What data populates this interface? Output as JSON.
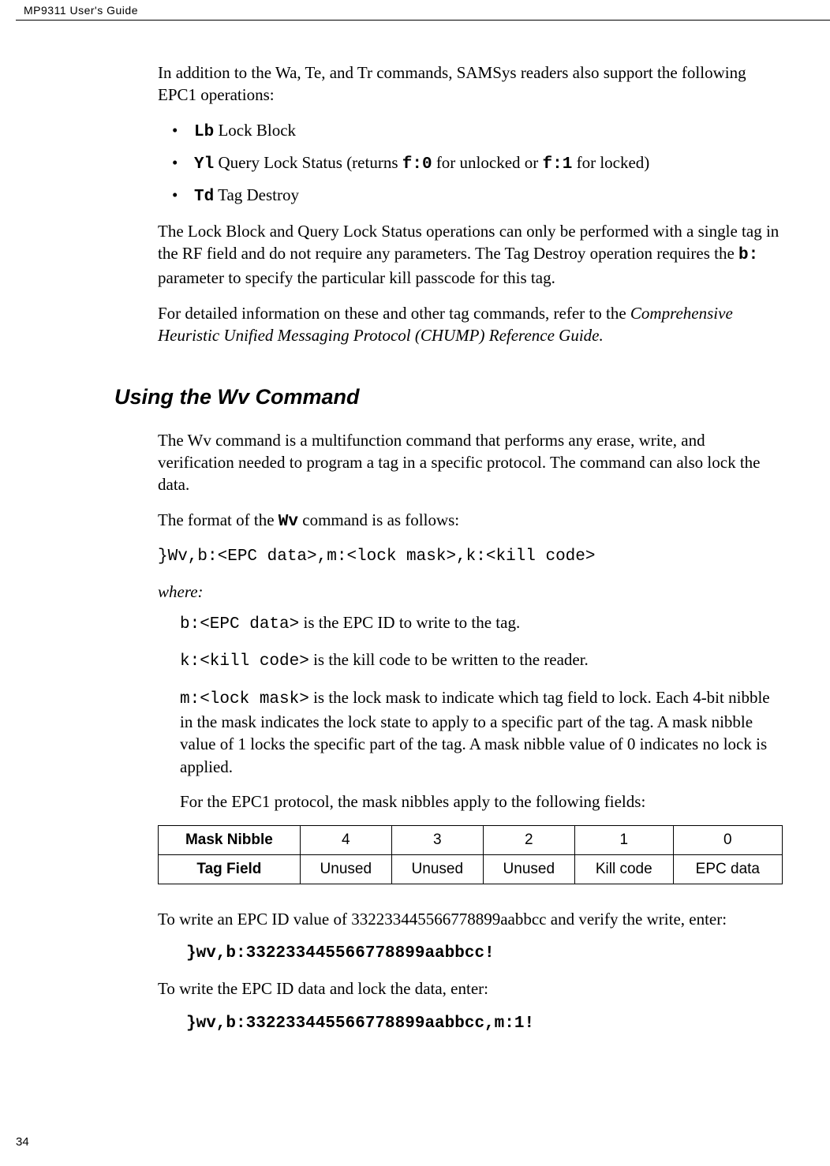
{
  "header_title": "MP9311 User's Guide",
  "intro": "In addition to the Wa, Te, and Tr commands, SAMSys readers also support the following EPC1 operations:",
  "bullets": {
    "lb_code": "Lb",
    "lb_text": " Lock Block",
    "yl_code": "Yl",
    "yl_text_1": " Query Lock Status (returns ",
    "yl_f0": "f:0",
    "yl_text_2": " for unlocked or ",
    "yl_f1": "f:1",
    "yl_text_3": " for locked)",
    "td_code": "Td",
    "td_text": " Tag Destroy"
  },
  "para2_1": "The Lock Block and Query Lock Status operations can only be performed with a single tag in the RF field and do not require any parameters.  The Tag Destroy operation requires the ",
  "para2_b": "b:",
  "para2_2": " parameter to specify the particular kill passcode for this tag.",
  "para3_1": "For detailed information on these and other tag commands, refer to the ",
  "para3_ref": "Comprehensive Heuristic Unified Messaging Protocol (CHUMP) Reference Guide.",
  "section_heading": "Using the Wv Command",
  "wv_intro": "The Wv command is a multifunction command that performs any erase, write, and verification needed to program a tag in a specific protocol. The command can also lock the data.",
  "wv_format_1": "The format of the ",
  "wv_format_code": "Wv",
  "wv_format_2": " command is as follows:",
  "format_line": "}Wv,b:<EPC data>,m:<lock mask>,k:<kill code>",
  "where_label": "where:",
  "where_b_code": "b:<EPC data>",
  "where_b_text": "  is the EPC ID to write to the tag.",
  "where_k_code": "k:<kill code>",
  "where_k_text": " is the kill code to be written to the reader.",
  "where_m_code": "m:<lock mask>",
  "where_m_text": "  is the lock mask to indicate which tag field to lock. Each 4-bit nibble in the mask indicates the lock state to apply to a specific part of the tag. A mask nibble value of 1 locks the specific part of the tag. A mask nibble value of 0 indicates no lock is applied.",
  "nibble_intro_1": "For t",
  "nibble_intro_2": "he EPC1 protocol, the mask nibbles apply to the following fields:",
  "table": {
    "row1": [
      "Mask Nibble",
      "4",
      "3",
      "2",
      "1",
      "0"
    ],
    "row2": [
      "Tag Field",
      "Unused",
      "Unused",
      "Unused",
      "Kill code",
      "EPC data"
    ]
  },
  "example1_text": "To write an EPC ID value of 332233445566778899aabbcc and verify the write, enter:",
  "example1_cmd": "}wv,b:332233445566778899aabbcc!",
  "example2_text": "To write the EPC ID data and lock the data, enter:",
  "example2_cmd": "}wv,b:332233445566778899aabbcc,m:1!",
  "page_number": "34"
}
